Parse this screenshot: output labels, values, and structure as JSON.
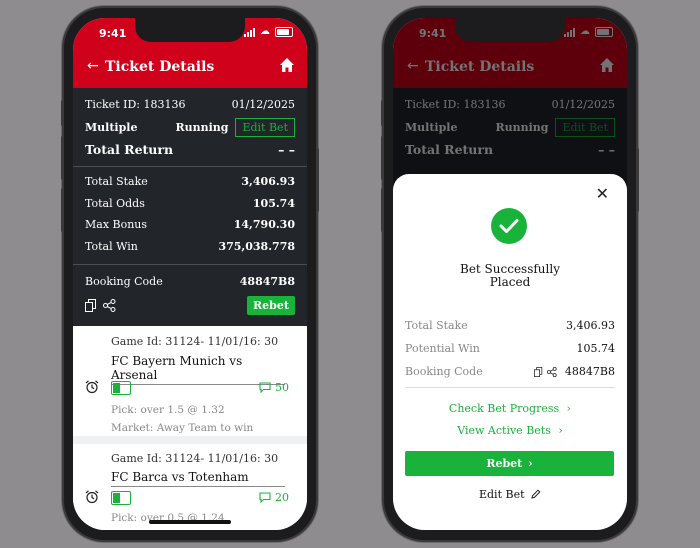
{
  "status": {
    "time": "9:41"
  },
  "appbar": {
    "title": "Ticket Details"
  },
  "ticket": {
    "id_label": "Ticket ID: 183136",
    "date": "01/12/2025",
    "type": "Multiple",
    "status": "Running",
    "edit_bet": "Edit Bet",
    "total_return_label": "Total Return",
    "total_return_value": "– –",
    "total_stake_label": "Total Stake",
    "total_stake_value": "3,406.93",
    "total_odds_label": "Total Odds",
    "total_odds_value": "105.74",
    "max_bonus_label": "Max Bonus",
    "max_bonus_value": "14,790.30",
    "total_win_label": "Total Win",
    "total_win_value": "375,038.778",
    "booking_code_label": "Booking Code",
    "booking_code_value": "48847B8",
    "rebet": "Rebet"
  },
  "games": [
    {
      "game_id": "Game Id: 31124- 11/01/16: 30",
      "teams": "FC Bayern Munich vs Arsenal",
      "count": "50",
      "pick": "Pick: over 1.5 @ 1.32",
      "market": "Market: Away Team to win"
    },
    {
      "game_id": "Game Id: 31124- 11/01/16: 30",
      "teams": "FC Barca vs Totenham",
      "count": "20",
      "pick": "Pick: over 0.5 @ 1.24"
    }
  ],
  "sheet": {
    "success_line1": "Bet Successfully",
    "success_line2": "Placed",
    "total_stake_label": "Total Stake",
    "total_stake_value": "3,406.93",
    "potential_win_label": "Potential Win",
    "potential_win_value": "105.74",
    "booking_code_label": "Booking Code",
    "booking_code_value": "48847B8",
    "check_progress": "Check Bet Progress",
    "view_active": "View Active Bets",
    "rebet": "Rebet",
    "edit_bet": "Edit Bet"
  },
  "colors": {
    "brand_red": "#d0021b",
    "accent_green": "#19b33b",
    "dark_panel": "#22252a"
  }
}
